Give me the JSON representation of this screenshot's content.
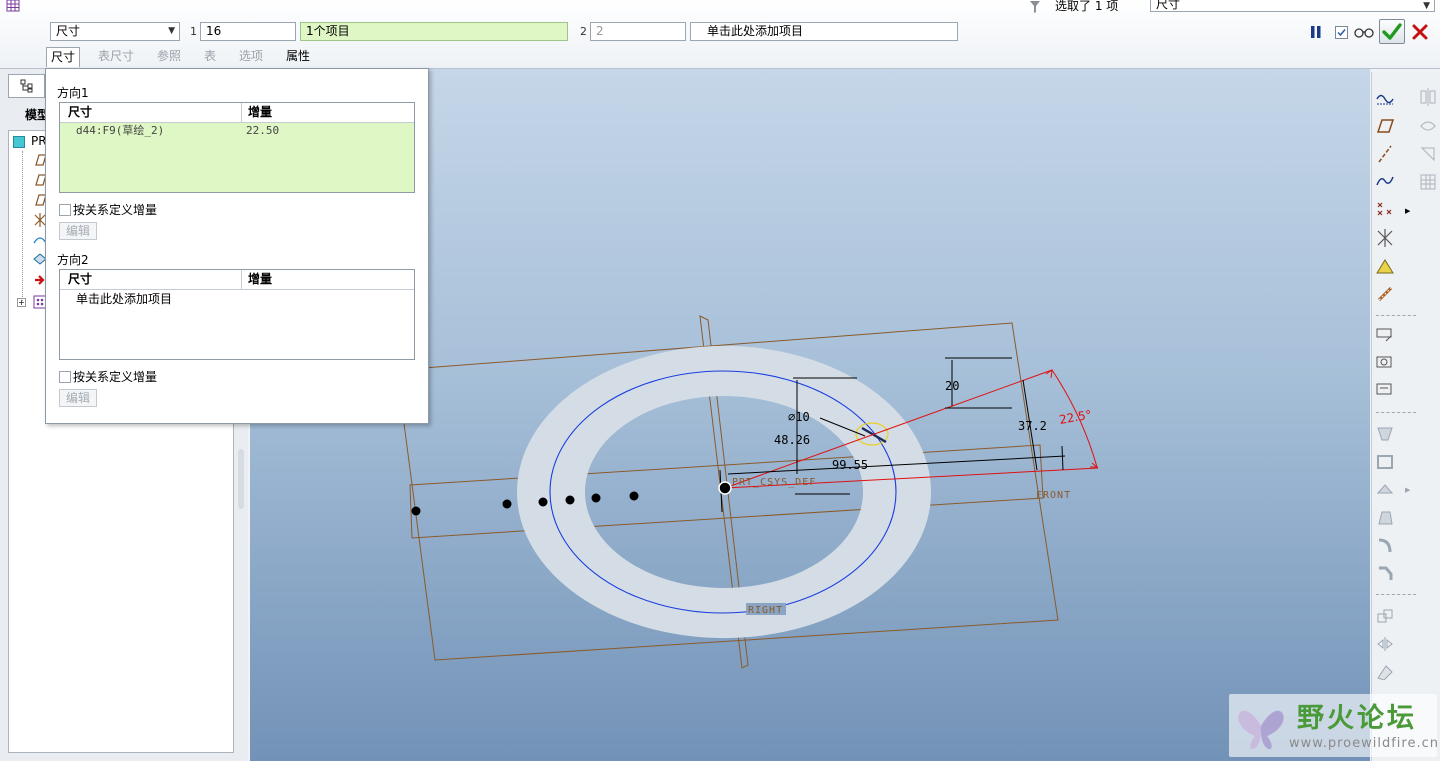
{
  "dashboard": {
    "dim_type": "尺寸",
    "row1_label": "1",
    "row1_value": "16",
    "row1_items": "1个项目",
    "row2_label": "2",
    "row2_value": "2",
    "row2_items": "单击此处添加项目",
    "selection_text": "选取了 1 项",
    "filter_value": "尺寸",
    "tabs": [
      "尺寸",
      "表尺寸",
      "参照",
      "表",
      "选项",
      "属性"
    ],
    "icons": {
      "pause": "pause-icon",
      "preview_checkbox": "checkbox-icon",
      "preview": "glasses-icon",
      "ok": "checkmark-icon",
      "cancel": "close-icon"
    },
    "ok_color": "#1f9a1f",
    "cancel_color": "#c81010"
  },
  "navigator": {
    "model_tree_title": "模型",
    "tree_root": "PR"
  },
  "panel": {
    "direction1_title": "方向1",
    "col_dimension": "尺寸",
    "col_increment": "增量",
    "direction1_rows": [
      {
        "dimension": "d44:F9(草绘_2)",
        "increment": "22.50"
      }
    ],
    "relation_checkbox": "按关系定义增量",
    "edit_button": "编辑",
    "direction2_title": "方向2",
    "direction2_placeholder": "单击此处添加项目"
  },
  "model": {
    "dim_diameter": "⌀10",
    "dim_48": "48.26",
    "dim_99": "99.55",
    "dim_20": "20",
    "dim_37": "37.2",
    "dim_angle": "22.5°",
    "csys_label": "PRT_CSYS_DEF",
    "front_label": "FRONT",
    "right_label": "RIGHT",
    "datum_color": "#8a5a2b",
    "sketch_color": "#1a3ee0",
    "angle_color": "#e01010"
  },
  "watermark": {
    "brand": "野火论坛",
    "url": "www.proewildfire.cn"
  }
}
